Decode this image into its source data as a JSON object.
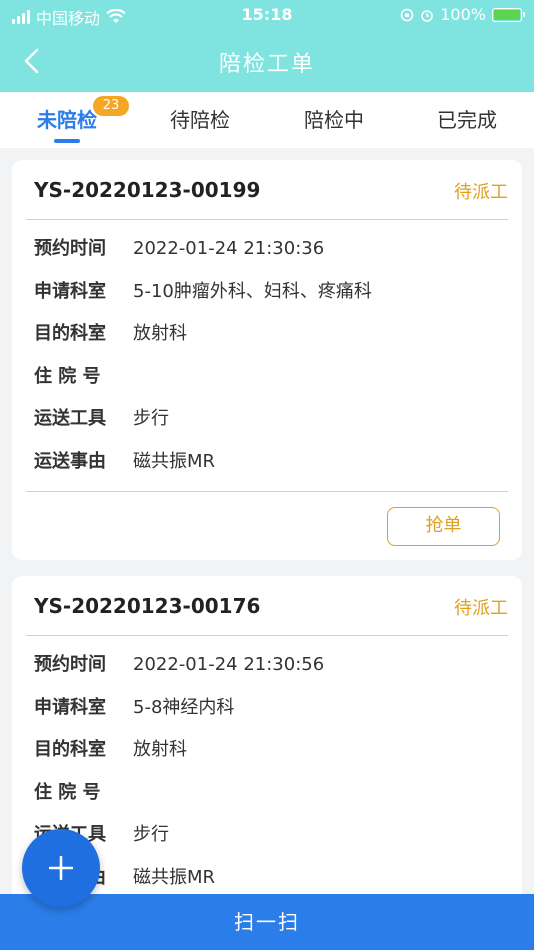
{
  "status_bar": {
    "carrier": "中国移动",
    "time": "15:18",
    "battery_percent": "100%",
    "battery_level": 1.0
  },
  "nav": {
    "title": "陪检工单"
  },
  "tabs": [
    {
      "label": "未陪检",
      "badge": "23",
      "active": true
    },
    {
      "label": "待陪检",
      "active": false
    },
    {
      "label": "陪检中",
      "active": false
    },
    {
      "label": "已完成",
      "active": false
    }
  ],
  "field_labels": {
    "appointment_time": "预约时间",
    "request_dept": "申请科室",
    "target_dept": "目的科室",
    "inpatient_no": "住 院 号",
    "transport_tool": "运送工具",
    "transport_reason": "运送事由"
  },
  "orders": [
    {
      "id": "YS-20220123-00199",
      "status": "待派工",
      "appointment_time": "2022-01-24 21:30:36",
      "request_dept": "5-10肿瘤外科、妇科、疼痛科",
      "target_dept": "放射科",
      "inpatient_no": "",
      "transport_tool": "步行",
      "transport_reason": "磁共振MR",
      "action_label": "抢单"
    },
    {
      "id": "YS-20220123-00176",
      "status": "待派工",
      "appointment_time": "2022-01-24 21:30:56",
      "request_dept": "5-8神经内科",
      "target_dept": "放射科",
      "inpatient_no": "",
      "transport_tool": "步行",
      "transport_reason": "磁共振MR"
    }
  ],
  "bottom_bar": {
    "label": "扫一扫"
  },
  "colors": {
    "header": "#7fe3df",
    "accent": "#2b7de9",
    "status": "#e0a020",
    "badge": "#f5a623"
  }
}
